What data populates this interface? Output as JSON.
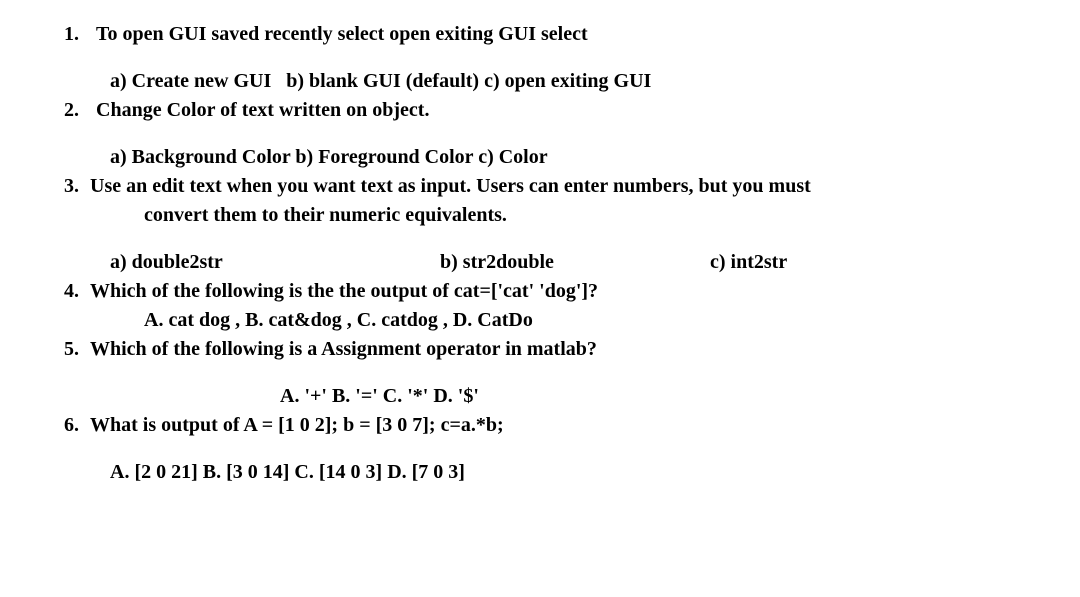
{
  "questions": {
    "q1": {
      "num": "1.",
      "text": "To open GUI saved recently select open exiting GUI select",
      "optA": "a) Create new GUI",
      "optB": "b) blank GUI (default)",
      "optC": "c) open exiting GUI"
    },
    "q2": {
      "num": "2.",
      "text": "Change Color of text written on object.",
      "optA": "a) Background Color",
      "optB": "b) Foreground Color",
      "optC": "c) Color"
    },
    "q3": {
      "num": "3.",
      "text1": "Use an edit text when you want text as input. Users can enter numbers, but you must",
      "text2": "convert them to their numeric equivalents.",
      "optA": "a) double2str",
      "optB": "b) str2double",
      "optC": "c) int2str"
    },
    "q4": {
      "num": "4.",
      "text": "Which of the following is the the output of cat=['cat' 'dog']?",
      "opts": "A. cat dog , B. cat&dog ,  C. catdog , D. CatDo"
    },
    "q5": {
      "num": "5.",
      "text": "Which of the following is a Assignment operator in matlab?",
      "opts": "A. '+' B. '=' C. '*' D. '$'"
    },
    "q6": {
      "num": "6.",
      "text": "What is output of A = [1 0 2]; b = [3 0 7]; c=a.*b;",
      "opts": "A. [2 0 21] B. [3 0 14] C. [14 0 3] D. [7 0 3]"
    }
  }
}
